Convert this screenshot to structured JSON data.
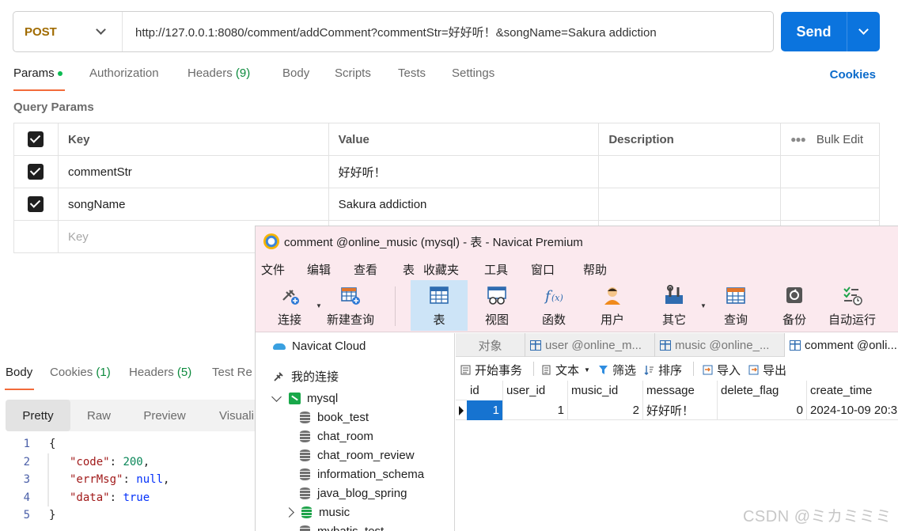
{
  "request": {
    "method": "POST",
    "url": "http://127.0.0.1:8080/comment/addComment?commentStr=好好听！&songName=Sakura addiction",
    "send_label": "Send"
  },
  "request_tabs": {
    "params": "Params",
    "authorization": "Authorization",
    "headers": "Headers",
    "headers_count": "(9)",
    "body": "Body",
    "scripts": "Scripts",
    "tests": "Tests",
    "settings": "Settings",
    "cookies": "Cookies"
  },
  "query_params": {
    "title": "Query Params",
    "headers": {
      "key": "Key",
      "value": "Value",
      "description": "Description",
      "bulk_edit": "Bulk Edit"
    },
    "rows": [
      {
        "key": "commentStr",
        "value": "好好听！",
        "checked": true
      },
      {
        "key": "songName",
        "value": "Sakura addiction",
        "checked": true
      }
    ],
    "key_placeholder": "Key"
  },
  "response_tabs": {
    "body": "Body",
    "cookies": "Cookies",
    "cookies_count": "(1)",
    "headers": "Headers",
    "headers_count": "(5)",
    "test_results": "Test Re"
  },
  "format_tabs": {
    "pretty": "Pretty",
    "raw": "Raw",
    "preview": "Preview",
    "visualize": "Visuali"
  },
  "response_lines": [
    {
      "n": "1",
      "text": "{"
    },
    {
      "n": "2",
      "key": "\"code\"",
      "sep": ": ",
      "value": "200",
      "tail": ","
    },
    {
      "n": "3",
      "key": "\"errMsg\"",
      "sep": ": ",
      "value": "null",
      "tail": ","
    },
    {
      "n": "4",
      "key": "\"data\"",
      "sep": ": ",
      "value": "true",
      "tail": ""
    },
    {
      "n": "5",
      "text": "}"
    }
  ],
  "navicat": {
    "title": "comment @online_music (mysql) - 表 - Navicat Premium",
    "menu": [
      "文件",
      "编辑",
      "查看",
      "表",
      "收藏夹",
      "工具",
      "窗口",
      "帮助"
    ],
    "toolbar": [
      "连接",
      "新建查询",
      "表",
      "视图",
      "函数",
      "用户",
      "其它",
      "查询",
      "备份",
      "自动运行"
    ],
    "tree": {
      "cloud": "Navicat Cloud",
      "my_connections": "我的连接",
      "connection": "mysql",
      "databases": [
        "book_test",
        "chat_room",
        "chat_room_review",
        "information_schema",
        "java_blog_spring",
        "music",
        "mybatis_test"
      ]
    },
    "tabs": [
      "对象",
      "user @online_m...",
      "music @online_...",
      "comment @onli..."
    ],
    "actions": [
      "开始事务",
      "文本",
      "筛选",
      "排序",
      "导入",
      "导出"
    ],
    "columns": [
      "id",
      "user_id",
      "music_id",
      "message",
      "delete_flag",
      "create_time"
    ],
    "rows": [
      {
        "id": "1",
        "user_id": "1",
        "music_id": "2",
        "message": "好好听！",
        "delete_flag": "0",
        "create_time": "2024-10-09 20:3"
      }
    ]
  },
  "watermark": "CSDN @ミカミミミ",
  "colors": {
    "send": "#0b74de",
    "tab_accent": "#f26b3a",
    "method": "#a06b00",
    "selection": "#1673d0"
  }
}
